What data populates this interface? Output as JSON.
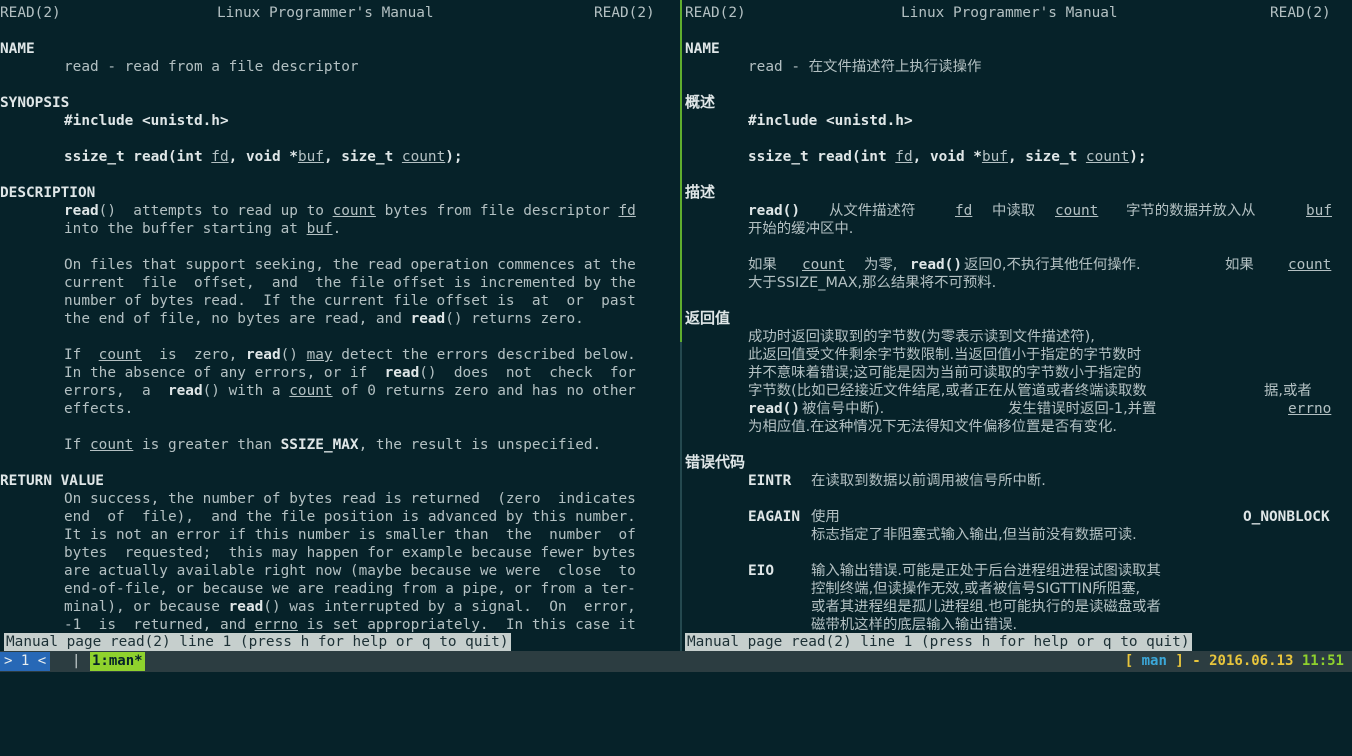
{
  "left": {
    "header_left": "READ(2)",
    "header_center": "Linux Programmer's Manual",
    "header_right": "READ(2)",
    "name_heading": "NAME",
    "name_text": "read - read from a file descriptor",
    "synopsis_heading": "SYNOPSIS",
    "include_line": "#include <unistd.h>",
    "sig_prefix": "ssize_t read(int ",
    "sig_fd": "fd",
    "sig_mid1": ", void *",
    "sig_buf": "buf",
    "sig_mid2": ", size_t ",
    "sig_count": "count",
    "sig_end": ");",
    "description_heading": "DESCRIPTION",
    "d1_read": "read",
    "d1_a": "()  attempts to read up to ",
    "d1_count": "count",
    "d1_b": " bytes from file descriptor ",
    "d1_fd": "fd",
    "d2_a": "into the buffer starting at ",
    "d2_buf": "buf",
    "d2_b": ".",
    "p2_1": "On files that support seeking, the read operation commences at the",
    "p2_2": "current  file  offset,  and  the file offset is incremented by the",
    "p2_3": "number of bytes read.  If the current file offset is  at  or  past",
    "p2_4a": "the end of file, no bytes are read, and ",
    "p2_4read": "read",
    "p2_4b": "() returns zero.",
    "p3_1a": "If  ",
    "p3_1count": "count",
    "p3_1b": "  is  zero, ",
    "p3_1read": "read",
    "p3_1c": "() ",
    "p3_1may": "may",
    "p3_1d": " detect the errors described below.",
    "p3_2a": "In the absence of any errors, or if  ",
    "p3_2read": "read",
    "p3_2b": "()  does  not  check  for",
    "p3_3a": "errors,  a  ",
    "p3_3read": "read",
    "p3_3b": "() with a ",
    "p3_3count": "count",
    "p3_3c": " of 0 returns zero and has no other",
    "p3_4": "effects.",
    "p4_a": "If ",
    "p4_count": "count",
    "p4_b": " is greater than ",
    "p4_ssize": "SSIZE_MAX",
    "p4_c": ", the result is unspecified.",
    "return_heading": "RETURN VALUE",
    "r1": "On success, the number of bytes read is returned  (zero  indicates",
    "r2": "end  of  file),  and the file position is advanced by this number.",
    "r3": "It is not an error if this number is smaller than  the  number  of",
    "r4": "bytes  requested;  this may happen for example because fewer bytes",
    "r5": "are actually available right now (maybe because we were  close  to",
    "r6": "end-of-file, or because we are reading from a pipe, or from a ter‐",
    "r7a": "minal), or because ",
    "r7read": "read",
    "r7b": "() was interrupted by a signal.  On  error,",
    "r8a": "-1  is  returned, and ",
    "r8errno": "errno",
    "r8b": " is set appropriately.  In this case it",
    "status": "Manual page read(2) line 1 (press h for help or q to quit)"
  },
  "right": {
    "header_left": "READ(2)",
    "header_center": "Linux Programmer's Manual",
    "header_right": "READ(2)",
    "name_heading": "NAME",
    "name_text_a": "read - ",
    "name_text_b": "在文件描述符上执行读操作",
    "synopsis_heading": "概述",
    "include_line": "#include <unistd.h>",
    "sig_prefix": "ssize_t read(int ",
    "sig_fd": "fd",
    "sig_mid1": ", void *",
    "sig_buf": "buf",
    "sig_mid2": ", size_t ",
    "sig_count": "count",
    "sig_end": ");",
    "description_heading": "描述",
    "d1_read": "read()",
    "d1_a": "从文件描述符",
    "d1_fd": "fd",
    "d1_b": "中读取",
    "d1_count": "count",
    "d1_c": "字节的数据并放入从",
    "d1_buf": "buf",
    "d2": "开始的缓冲区中.",
    "p2_a": "如果",
    "p2_count": "count",
    "p2_b": "为零,",
    "p2_read": "read()",
    "p2_c": "返回0,不执行其他任何操作.",
    "p2_d": "如果",
    "p2_count2": "count",
    "p2_2": "大于SSIZE_MAX,那么结果将不可预料.",
    "return_heading": "返回值",
    "r1": "成功时返回读取到的字节数(为零表示读到文件描述符),",
    "r2": "此返回值受文件剩余字节数限制.当返回值小于指定的字节数时",
    "r3": "并不意味着错误;这可能是因为当前可读取的字节数小于指定的",
    "r4a": "字节数(比如已经接近文件结尾,或者正在从管道或者终端读取数",
    "r4b": "据,或者",
    "r5read": "read()",
    "r5a": "被信号中断).",
    "r5b": "发生错误时返回-1,并置",
    "r5errno": "errno",
    "r6": "为相应值.在这种情况下无法得知文件偏移位置是否有变化.",
    "errors_heading": "错误代码",
    "e1_name": "EINTR",
    "e1_text": "在读取到数据以前调用被信号所中断.",
    "e2_name": "EAGAIN",
    "e2_text_a": "使用",
    "e2_nonblock": "O_NONBLOCK",
    "e2_text_b": "标志指定了非阻塞式输入输出,但当前没有数据可读.",
    "e3_name": "EIO",
    "e3_1": "输入输出错误.可能是正处于后台进程组进程试图读取其",
    "e3_2": "控制终端,但读操作无效,或者被信号SIGTTIN所阻塞,",
    "e3_3": "或者其进程组是孤儿进程组.也可能执行的是读磁盘或者",
    "e3_4": "磁带机这样的底层输入输出错误.",
    "status": "Manual page read(2) line 1 (press h for help or q to quit)"
  },
  "tmux": {
    "session_index": "> 1 <",
    "separator": "|",
    "window_label": "1:man*",
    "bracket_open": "[",
    "process": "man",
    "bracket_close": "]",
    "dash": "-",
    "date": "2016.06.13",
    "time": "11:51"
  },
  "colors": {
    "background": "#062229",
    "text": "#b3c0c2",
    "bold_text": "#dfe6e7",
    "active_divider": "#5fae2e",
    "status_bg": "#c6cfcd",
    "tmux_index_bg": "#2768b6",
    "tmux_window_bg": "#8fd22d",
    "tmux_yellow": "#e8c53c",
    "tmux_cyan": "#3ba7d8"
  }
}
